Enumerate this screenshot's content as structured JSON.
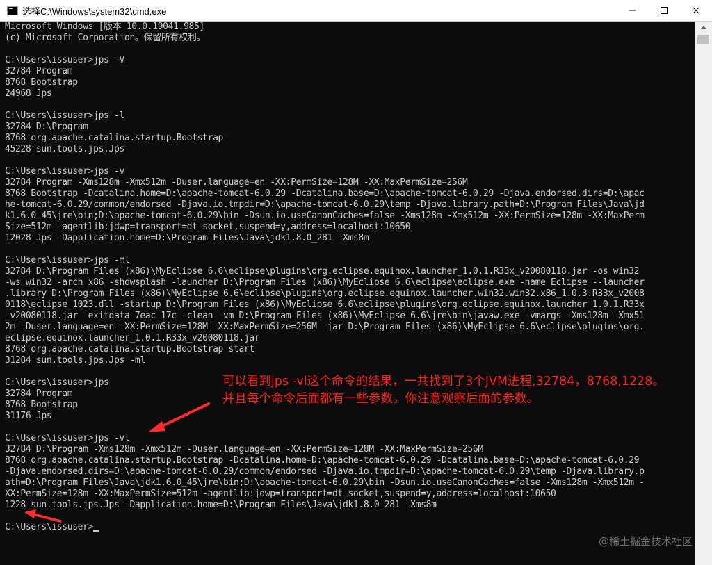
{
  "window": {
    "title": "选择C:\\Windows\\system32\\cmd.exe"
  },
  "console": {
    "lines": [
      "Microsoft Windows [版本 10.0.19041.985]",
      "(c) Microsoft Corporation。保留所有权利。",
      "",
      "C:\\Users\\issuser>jps -V",
      "32784 Program",
      "8768 Bootstrap",
      "24968 Jps",
      "",
      "C:\\Users\\issuser>jps -l",
      "32784 D:\\Program",
      "8768 org.apache.catalina.startup.Bootstrap",
      "45228 sun.tools.jps.Jps",
      "",
      "C:\\Users\\issuser>jps -v",
      "32784 Program -Xms128m -Xmx512m -Duser.language=en -XX:PermSize=128M -XX:MaxPermSize=256M",
      "8768 Bootstrap -Dcatalina.home=D:\\apache-tomcat-6.0.29 -Dcatalina.base=D:\\apache-tomcat-6.0.29 -Djava.endorsed.dirs=D:\\apac",
      "he-tomcat-6.0.29/common/endorsed -Djava.io.tmpdir=D:\\apache-tomcat-6.0.29\\temp -Djava.library.path=D:\\Program Files\\Java\\jd",
      "k1.6.0_45\\jre\\bin;D:\\apache-tomcat-6.0.29\\bin -Dsun.io.useCanonCaches=false -Xms128m -Xmx512m -XX:PermSize=128m -XX:MaxPerm",
      "Size=512m -agentlib:jdwp=transport=dt_socket,suspend=y,address=localhost:10650",
      "12028 Jps -Dapplication.home=D:\\Program Files\\Java\\jdk1.8.0_281 -Xms8m",
      "",
      "C:\\Users\\issuser>jps -ml",
      "32784 D:\\Program Files (x86)\\MyEclipse 6.6\\eclipse\\plugins\\org.eclipse.equinox.launcher_1.0.1.R33x_v20080118.jar -os win32",
      "-ws win32 -arch x86 -showsplash -launcher D:\\Program Files (x86)\\MyEclipse 6.6\\eclipse\\eclipse.exe -name Eclipse --launcher",
      ".library D:\\Program Files (x86)\\MyEclipse 6.6\\eclipse\\plugins\\org.eclipse.equinox.launcher.win32.win32.x86_1.0.3.R33x_v2008",
      "0118\\eclipse_1023.dll -startup D:\\Program Files (x86)\\MyEclipse 6.6\\eclipse\\plugins\\org.eclipse.equinox.launcher_1.0.1.R33x",
      "_v20080118.jar -exitdata 7eac_17c -clean -vm D:\\Program Files (x86)\\MyEclipse 6.6\\jre\\bin\\javaw.exe -vmargs -Xms128m -Xmx51",
      "2m -Duser.language=en -XX:PermSize=128M -XX:MaxPermSize=256M -jar D:\\Program Files (x86)\\MyEclipse 6.6\\eclipse\\plugins\\org.",
      "eclipse.equinox.launcher_1.0.1.R33x_v20080118.jar",
      "8768 org.apache.catalina.startup.Bootstrap start",
      "31284 sun.tools.jps.Jps -ml",
      "",
      "C:\\Users\\issuser>jps",
      "32784 Program",
      "8768 Bootstrap",
      "31176 Jps",
      "",
      "C:\\Users\\issuser>jps -vl",
      "32784 D:\\Program -Xms128m -Xmx512m -Duser.language=en -XX:PermSize=128M -XX:MaxPermSize=256M",
      "8768 org.apache.catalina.startup.Bootstrap -Dcatalina.home=D:\\apache-tomcat-6.0.29 -Dcatalina.base=D:\\apache-tomcat-6.0.29",
      "-Djava.endorsed.dirs=D:\\apache-tomcat-6.0.29/common/endorsed -Djava.io.tmpdir=D:\\apache-tomcat-6.0.29\\temp -Djava.library.p",
      "ath=D:\\Program Files\\Java\\jdk1.6.0_45\\jre\\bin;D:\\apache-tomcat-6.0.29\\bin -Dsun.io.useCanonCaches=false -Xms128m -Xmx512m -",
      "XX:PermSize=128m -XX:MaxPermSize=512m -agentlib:jdwp=transport=dt_socket,suspend=y,address=localhost:10650",
      "1228 sun.tools.jps.Jps -Dapplication.home=D:\\Program Files\\Java\\jdk1.8.0_281 -Xms8m",
      "",
      "C:\\Users\\issuser>"
    ]
  },
  "annotation": {
    "text": "可以看到jps -vl这个命令的结果，一共找到了3个JVM进程,32784，8768,1228。并且每个命令后面都有一些参数。你注意观察后面的参数。",
    "color": "#ff2020"
  },
  "watermark": {
    "text": "@稀土掘金技术社区"
  },
  "colors": {
    "console_bg": "#0c0c0c",
    "console_text": "#cccccc",
    "titlebar_bg": "#ffffff"
  }
}
